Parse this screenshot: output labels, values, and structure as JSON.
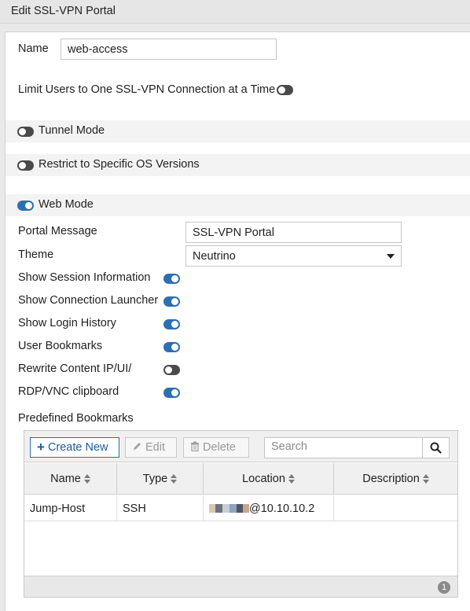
{
  "window": {
    "title": "Edit SSL-VPN Portal"
  },
  "name_field": {
    "label": "Name",
    "value": "web-access"
  },
  "limit_users": {
    "label": "Limit Users to One SSL-VPN Connection at a Time",
    "enabled": false
  },
  "tunnel_mode": {
    "label": "Tunnel Mode",
    "enabled": false
  },
  "restrict_os": {
    "label": "Restrict to Specific OS Versions",
    "enabled": false
  },
  "web_mode": {
    "label": "Web Mode",
    "enabled": true,
    "portal_message": {
      "label": "Portal Message",
      "value": "SSL-VPN Portal"
    },
    "theme": {
      "label": "Theme",
      "value": "Neutrino"
    },
    "options": [
      {
        "label": "Show Session Information",
        "enabled": true
      },
      {
        "label": "Show Connection Launcher",
        "enabled": true
      },
      {
        "label": "Show Login History",
        "enabled": true
      },
      {
        "label": "User Bookmarks",
        "enabled": true
      },
      {
        "label": "Rewrite Content IP/UI/",
        "enabled": false
      },
      {
        "label": "RDP/VNC clipboard",
        "enabled": true
      }
    ]
  },
  "bookmarks": {
    "label": "Predefined Bookmarks",
    "toolbar": {
      "create_label": "Create New",
      "edit_label": "Edit",
      "delete_label": "Delete",
      "search_placeholder": "Search"
    },
    "columns": [
      "Name",
      "Type",
      "Location",
      "Description"
    ],
    "rows": [
      {
        "name": "Jump-Host",
        "type": "SSH",
        "location_suffix": "@10.10.10.2",
        "description": ""
      }
    ],
    "count": "1"
  },
  "colors": {
    "accent": "#2c6fb3",
    "toggle_off": "#4a4a4a"
  }
}
